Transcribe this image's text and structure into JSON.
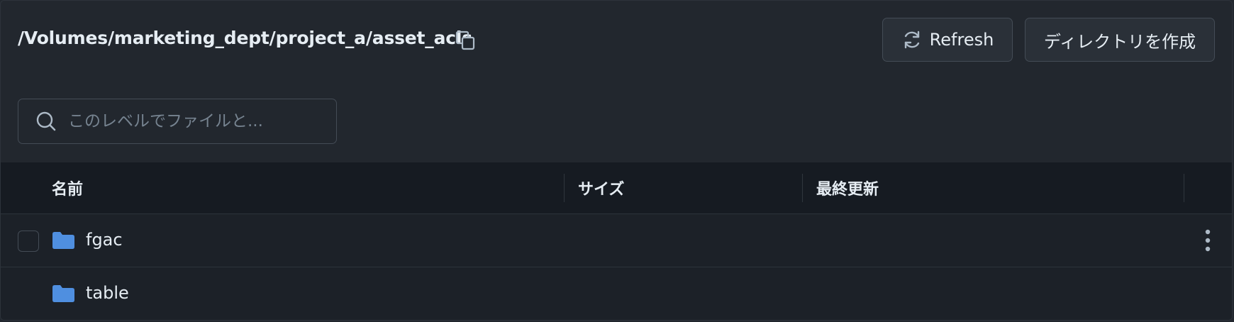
{
  "header": {
    "path": "/Volumes/marketing_dept/project_a/asset_acls",
    "copy_icon": "copy-icon",
    "refresh_label": "Refresh",
    "refresh_icon": "refresh-icon",
    "create_dir_label": "ディレクトリを作成"
  },
  "search": {
    "placeholder": "このレベルでファイルと...",
    "icon": "search-icon"
  },
  "table": {
    "columns": [
      "名前",
      "サイズ",
      "最終更新"
    ],
    "rows": [
      {
        "name": "fgac",
        "icon": "folder-icon",
        "has_checkbox": true,
        "has_menu": true
      },
      {
        "name": "table",
        "icon": "folder-icon",
        "has_checkbox": false,
        "has_menu": false
      }
    ]
  },
  "colors": {
    "background": "#22272e",
    "table_header": "#161b22",
    "folder": "#4f8fe0",
    "text": "#e6edf3",
    "muted": "#768390",
    "border": "#444c56"
  }
}
